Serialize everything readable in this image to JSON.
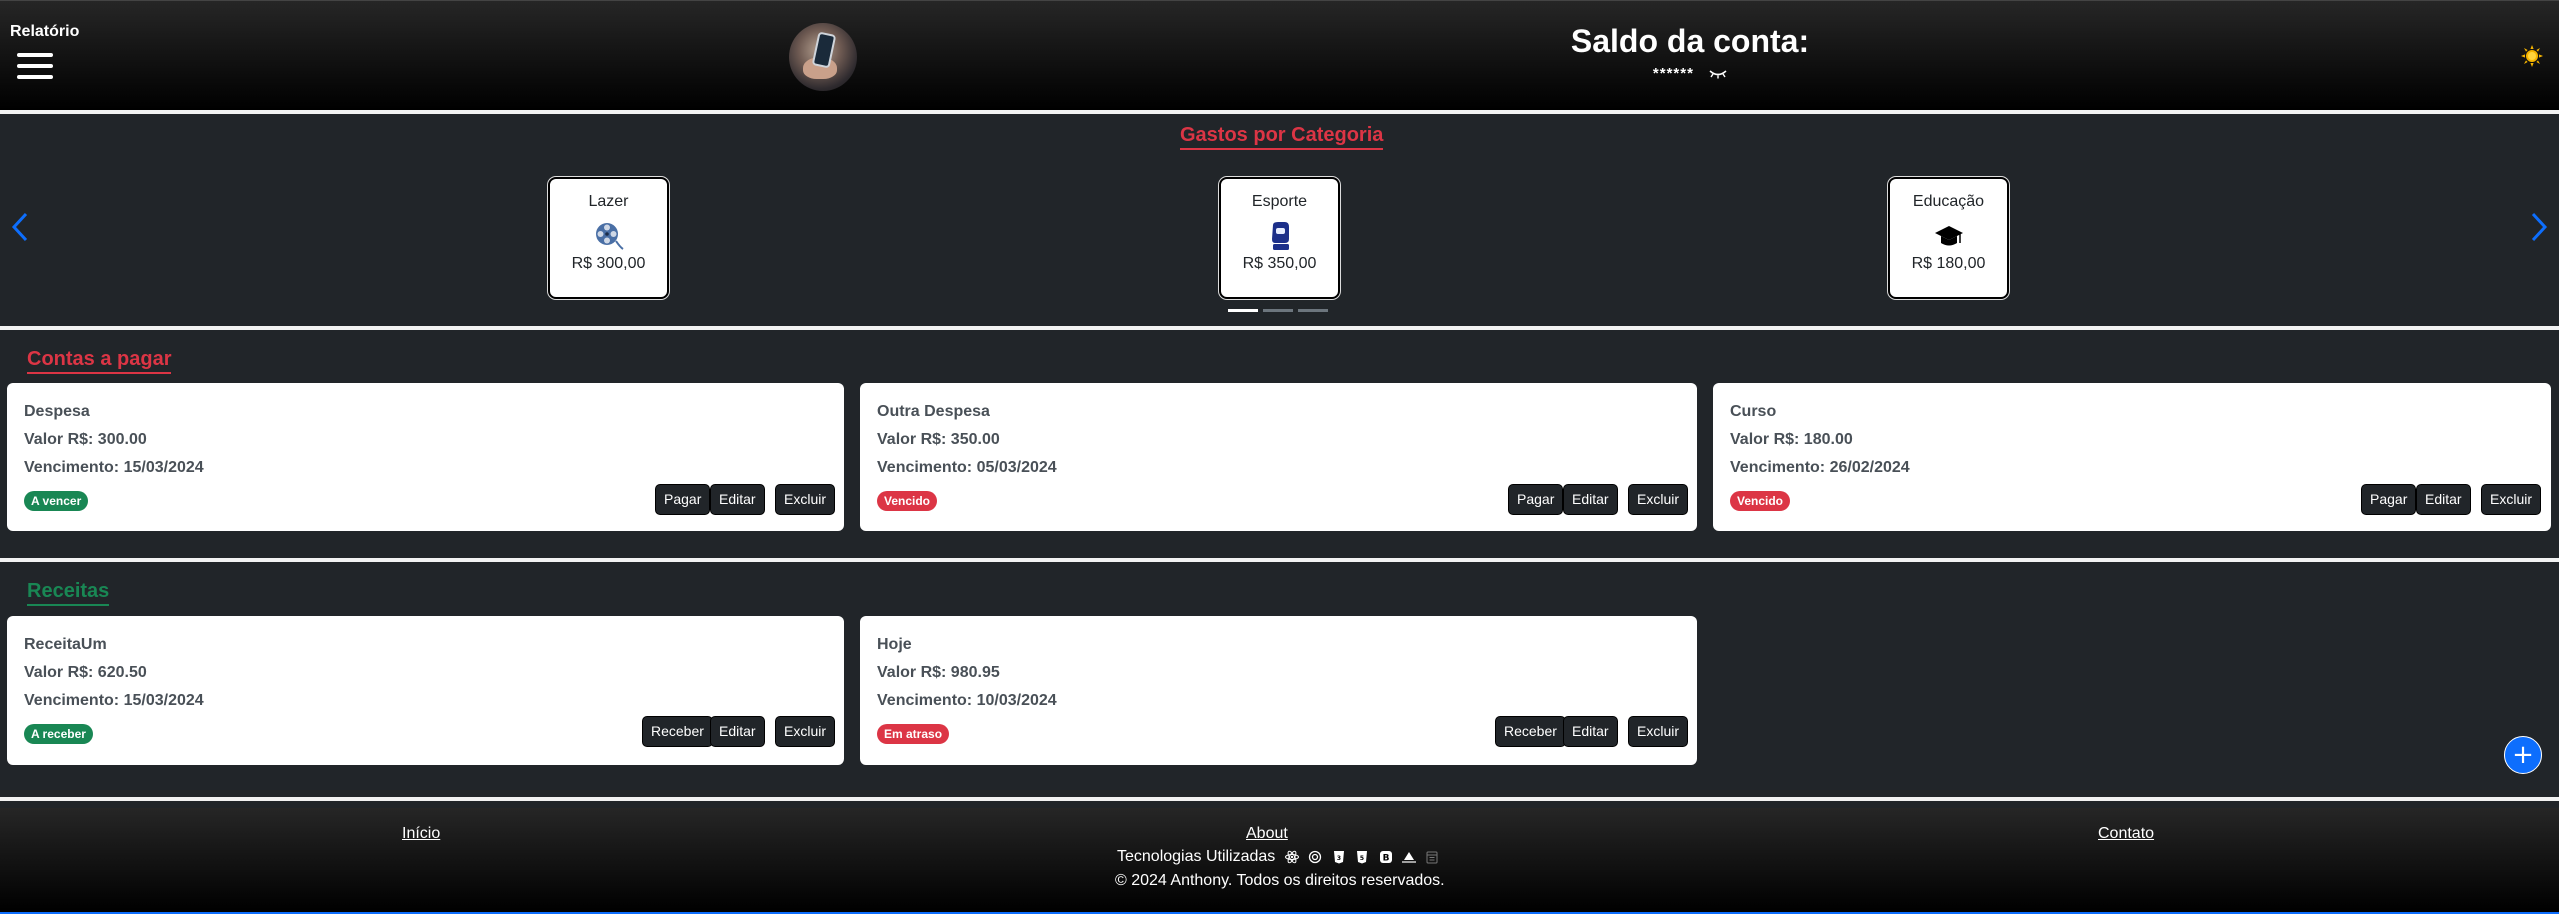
{
  "header": {
    "menu_label": "Relatório",
    "balance_title": "Saldo da conta:",
    "balance_value": "******"
  },
  "categories": {
    "title": "Gastos por Categoria",
    "items": [
      {
        "name": "Lazer",
        "value": "R$ 300,00",
        "icon": "film-reel-icon"
      },
      {
        "name": "Esporte",
        "value": "R$ 350,00",
        "icon": "boxing-glove-icon"
      },
      {
        "name": "Educação",
        "value": "R$ 180,00",
        "icon": "graduation-cap-icon"
      }
    ],
    "slide_count": 3,
    "active_slide": 0
  },
  "bills": {
    "title": "Contas a pagar",
    "items": [
      {
        "name": "Despesa",
        "amount": "Valor R$: 300.00",
        "due": "Vencimento: 15/03/2024",
        "status": "A vencer",
        "status_color": "#198754"
      },
      {
        "name": "Outra Despesa",
        "amount": "Valor R$: 350.00",
        "due": "Vencimento: 05/03/2024",
        "status": "Vencido",
        "status_color": "#dc3545"
      },
      {
        "name": "Curso",
        "amount": "Valor R$: 180.00",
        "due": "Vencimento: 26/02/2024",
        "status": "Vencido",
        "status_color": "#dc3545"
      }
    ],
    "actions": {
      "pay": "Pagar",
      "edit": "Editar",
      "delete": "Excluir"
    }
  },
  "incomes": {
    "title": "Receitas",
    "items": [
      {
        "name": "ReceitaUm",
        "amount": "Valor R$: 620.50",
        "due": "Vencimento: 15/03/2024",
        "status": "A receber",
        "status_color": "#198754"
      },
      {
        "name": "Hoje",
        "amount": "Valor R$: 980.95",
        "due": "Vencimento: 10/03/2024",
        "status": "Em atraso",
        "status_color": "#dc3545"
      }
    ],
    "actions": {
      "receive": "Receber",
      "edit": "Editar",
      "delete": "Excluir"
    }
  },
  "fab_label": "+",
  "footer": {
    "links": {
      "home": "Início",
      "about": "About",
      "contact": "Contato"
    },
    "tech_label": "Tecnologias Utilizadas",
    "tech_icons": [
      "react-icon",
      "openai-icon",
      "css3-icon",
      "html5-icon",
      "bootstrap-icon",
      "netlify-icon",
      "calendar-icon"
    ],
    "copyright": "© 2024 Anthony. Todos os direitos reservados."
  },
  "colors": {
    "accent_red": "#dc3545",
    "accent_green": "#198754",
    "accent_blue": "#0d6efd",
    "background": "#212529"
  }
}
